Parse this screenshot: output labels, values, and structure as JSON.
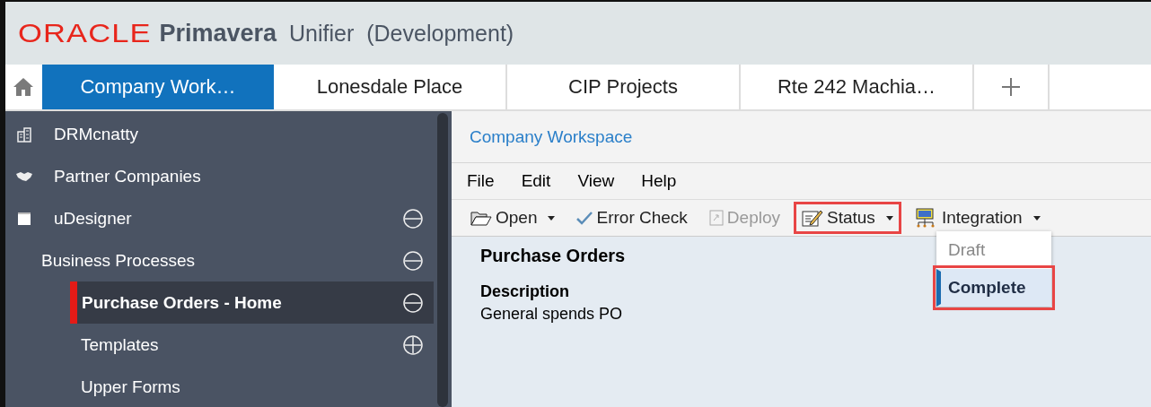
{
  "header": {
    "brand": "ORACLE",
    "product": "Primavera",
    "app": "Unifier",
    "environment": "(Development)"
  },
  "tabs": [
    {
      "label": "Company Work…",
      "selected": true
    },
    {
      "label": "Lonesdale Place",
      "selected": false
    },
    {
      "label": "CIP Projects",
      "selected": false
    },
    {
      "label": "Rte 242 Machia…",
      "selected": false
    }
  ],
  "sidebar": {
    "items": [
      {
        "label": "DRMcnatty",
        "selected": false
      },
      {
        "label": "Partner Companies",
        "selected": false
      },
      {
        "label": "uDesigner",
        "selected": false,
        "expanded": true,
        "children": [
          {
            "label": "Business Processes",
            "selected": false,
            "expanded": true,
            "children": [
              {
                "label": "Purchase Orders - Home",
                "selected": true,
                "expanded": true,
                "children": [
                  {
                    "label": "Templates",
                    "selected": false,
                    "expanded": false
                  },
                  {
                    "label": "Upper Forms",
                    "selected": false
                  }
                ]
              }
            ]
          }
        ]
      }
    ]
  },
  "breadcrumb": "Company Workspace",
  "menu": [
    "File",
    "Edit",
    "View",
    "Help"
  ],
  "toolbar": [
    {
      "label": "Open",
      "dropdown": true,
      "disabled": false,
      "highlighted": false
    },
    {
      "label": "Error Check",
      "dropdown": false,
      "disabled": false,
      "highlighted": false
    },
    {
      "label": "Deploy",
      "dropdown": false,
      "disabled": true,
      "highlighted": false
    },
    {
      "label": "Status",
      "dropdown": true,
      "disabled": false,
      "highlighted": true
    },
    {
      "label": "Integration",
      "dropdown": true,
      "disabled": false,
      "highlighted": false
    }
  ],
  "status_menu": [
    {
      "label": "Draft",
      "disabled": true,
      "selected": false,
      "highlighted": false
    },
    {
      "label": "Complete",
      "disabled": false,
      "selected": true,
      "highlighted": true
    }
  ],
  "content": {
    "title": "Purchase Orders",
    "description_label": "Description",
    "description": "General spends PO"
  }
}
